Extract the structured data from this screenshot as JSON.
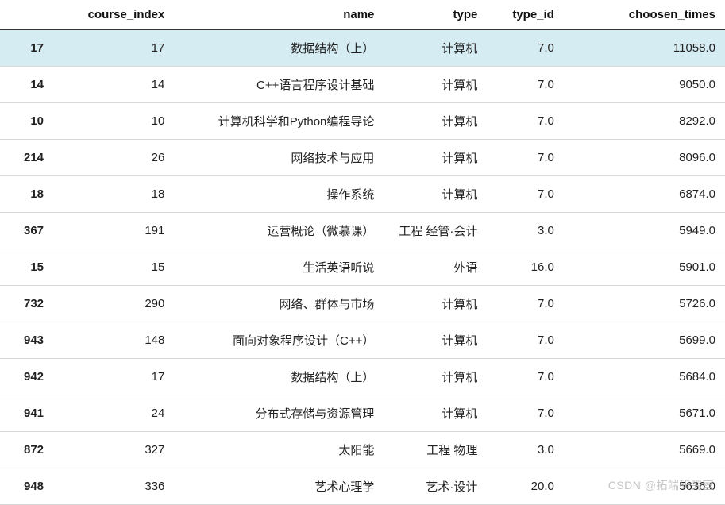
{
  "columns": {
    "index": "",
    "course_index": "course_index",
    "name": "name",
    "type": "type",
    "type_id": "type_id",
    "choosen_times": "choosen_times"
  },
  "highlight_row_index": 0,
  "rows": [
    {
      "idx": "17",
      "course_index": "17",
      "name": "数据结构（上）",
      "type": "计算机",
      "type_id": "7.0",
      "choosen_times": "11058.0"
    },
    {
      "idx": "14",
      "course_index": "14",
      "name": "C++语言程序设计基础",
      "type": "计算机",
      "type_id": "7.0",
      "choosen_times": "9050.0"
    },
    {
      "idx": "10",
      "course_index": "10",
      "name": "计算机科学和Python编程导论",
      "type": "计算机",
      "type_id": "7.0",
      "choosen_times": "8292.0"
    },
    {
      "idx": "214",
      "course_index": "26",
      "name": "网络技术与应用",
      "type": "计算机",
      "type_id": "7.0",
      "choosen_times": "8096.0"
    },
    {
      "idx": "18",
      "course_index": "18",
      "name": "操作系统",
      "type": "计算机",
      "type_id": "7.0",
      "choosen_times": "6874.0"
    },
    {
      "idx": "367",
      "course_index": "191",
      "name": "运营概论（微慕课）",
      "type": "工程 经管·会计",
      "type_id": "3.0",
      "choosen_times": "5949.0"
    },
    {
      "idx": "15",
      "course_index": "15",
      "name": "生活英语听说",
      "type": "外语",
      "type_id": "16.0",
      "choosen_times": "5901.0"
    },
    {
      "idx": "732",
      "course_index": "290",
      "name": "网络、群体与市场",
      "type": "计算机",
      "type_id": "7.0",
      "choosen_times": "5726.0"
    },
    {
      "idx": "943",
      "course_index": "148",
      "name": "面向对象程序设计（C++）",
      "type": "计算机",
      "type_id": "7.0",
      "choosen_times": "5699.0"
    },
    {
      "idx": "942",
      "course_index": "17",
      "name": "数据结构（上）",
      "type": "计算机",
      "type_id": "7.0",
      "choosen_times": "5684.0"
    },
    {
      "idx": "941",
      "course_index": "24",
      "name": "分布式存储与资源管理",
      "type": "计算机",
      "type_id": "7.0",
      "choosen_times": "5671.0"
    },
    {
      "idx": "872",
      "course_index": "327",
      "name": "太阳能",
      "type": "工程 物理",
      "type_id": "3.0",
      "choosen_times": "5669.0"
    },
    {
      "idx": "948",
      "course_index": "336",
      "name": "艺术心理学",
      "type": "艺术·设计",
      "type_id": "20.0",
      "choosen_times": "5636.0"
    }
  ],
  "watermark": "CSDN @拓端研究室"
}
